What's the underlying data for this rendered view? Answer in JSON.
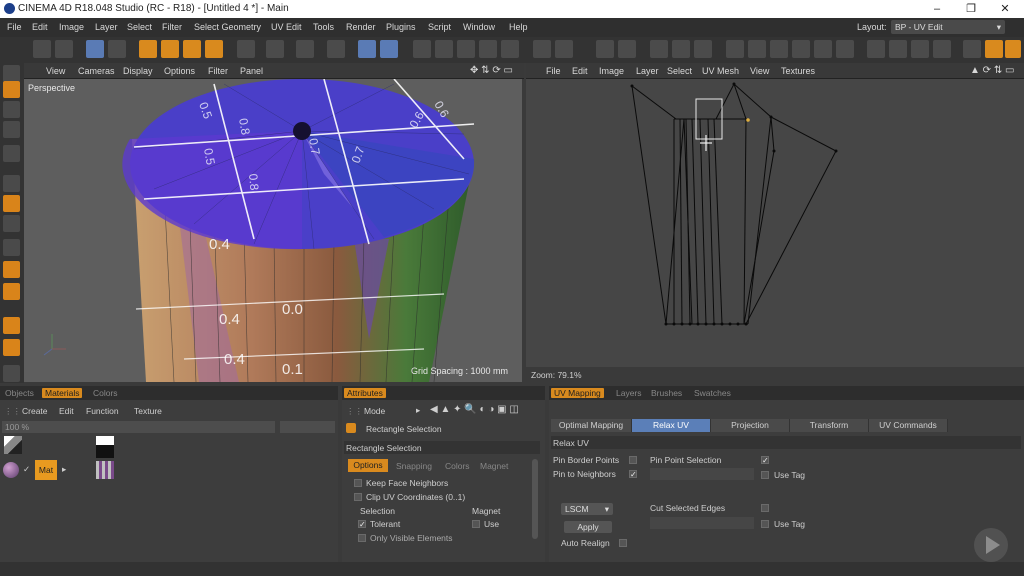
{
  "window": {
    "title": "CINEMA 4D R18.048 Studio (RC - R18) - [Untitled 4 *] - Main",
    "minimize": "–",
    "maximize": "❐",
    "close": "✕"
  },
  "menu": [
    "File",
    "Edit",
    "Image",
    "Layer",
    "Select",
    "Filter",
    "Select Geometry",
    "UV Edit",
    "Tools",
    "Render",
    "Plugins",
    "Script",
    "Window",
    "Help"
  ],
  "layout": {
    "label": "Layout:",
    "value": "BP - UV Edit"
  },
  "viewport": {
    "menu": [
      "View",
      "Cameras",
      "Display",
      "Options",
      "Filter",
      "Panel"
    ],
    "name": "Perspective",
    "grid_spacing": "Grid Spacing : 1000 mm",
    "uv_numbers_top": [
      "0.5",
      "0.6",
      "0.8",
      "0.5",
      "0.7",
      "0.8",
      "0.6",
      "0.7"
    ],
    "uv_numbers_side": [
      "0.4",
      "0.4",
      "0.0",
      "0.4",
      "0.1"
    ]
  },
  "uv_view": {
    "menu": [
      "File",
      "Edit",
      "Image",
      "Layer",
      "Select",
      "UV Mesh",
      "View",
      "Textures"
    ],
    "zoom": "Zoom: 79.1%"
  },
  "materials": {
    "tabs": [
      "Objects",
      "Materials",
      "Colors"
    ],
    "menu": [
      "Create",
      "Edit",
      "Function",
      "Texture"
    ],
    "percent": "100 %",
    "material_name": "Mat"
  },
  "attributes": {
    "tab": "Attributes",
    "mode": "Mode",
    "tool_name": "Rectangle Selection",
    "section_title": "Rectangle Selection",
    "subtabs": [
      "Options",
      "Snapping",
      "Colors",
      "Magnet"
    ],
    "keep_face_neighbors": "Keep Face Neighbors",
    "clip_uv": "Clip UV Coordinates (0..1)",
    "selection_label": "Selection",
    "magnet_label": "Magnet",
    "tolerant": "Tolerant",
    "use": "Use",
    "only_visible": "Only Visible Elements"
  },
  "uv_mapping": {
    "tabs": [
      "UV Mapping",
      "Layers",
      "Brushes",
      "Swatches"
    ],
    "subtabs": [
      "Optimal Mapping",
      "Relax UV",
      "Projection",
      "Transform",
      "UV Commands"
    ],
    "section": "Relax UV",
    "pin_border": "Pin Border Points",
    "pin_neighbors": "Pin to Neighbors",
    "pin_point_selection": "Pin Point Selection",
    "use_tag_1": "Use Tag",
    "method": "LSCM",
    "apply": "Apply",
    "auto_realign": "Auto Realign",
    "cut_selected_edges": "Cut Selected Edges",
    "use_tag_2": "Use Tag"
  },
  "colors": {
    "accent": "#d98a1e",
    "selected_tab": "#5b7fb8",
    "uv_bg": "#464646"
  }
}
